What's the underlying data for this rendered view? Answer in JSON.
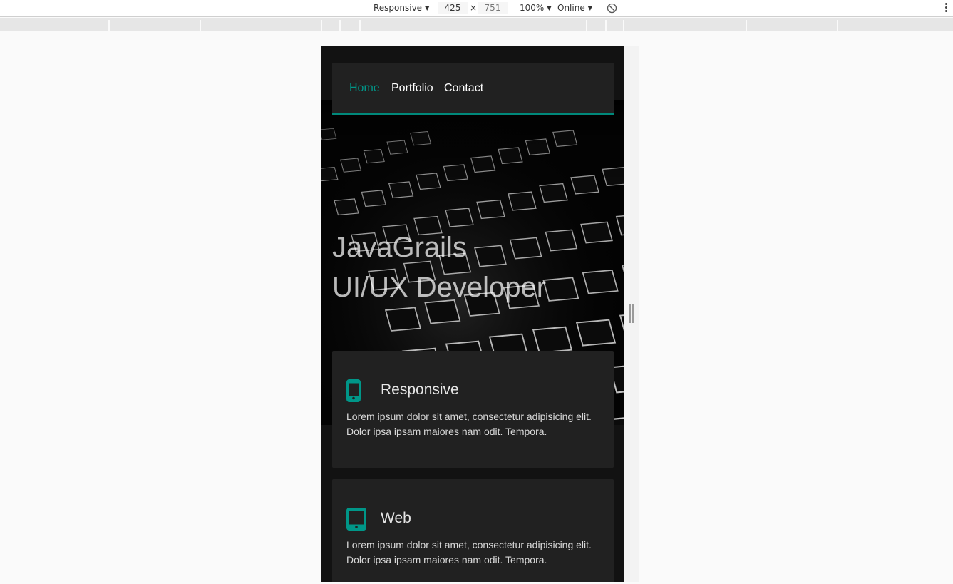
{
  "devtools": {
    "device": "Responsive",
    "width": "425",
    "times": "×",
    "height": "751",
    "zoom": "100%",
    "network": "Online"
  },
  "nav": {
    "items": [
      {
        "label": "Home",
        "active": true
      },
      {
        "label": "Portfolio",
        "active": false
      },
      {
        "label": "Contact",
        "active": false
      }
    ]
  },
  "hero": {
    "line1": "JavaGrails",
    "line2": "UI/UX Developer"
  },
  "cards": [
    {
      "icon": "phone-icon",
      "title": "Responsive",
      "text": "Lorem ipsum dolor sit amet, consectetur adipisicing elit. Dolor ipsa ipsam maiores nam odit. Tempora."
    },
    {
      "icon": "tablet-icon",
      "title": "Web",
      "text": "Lorem ipsum dolor sit amet, consectetur adipisicing elit. Dolor ipsa ipsam maiores nam odit. Tempora."
    }
  ],
  "colors": {
    "accent": "#009688",
    "card": "#212121",
    "page": "#121212"
  }
}
